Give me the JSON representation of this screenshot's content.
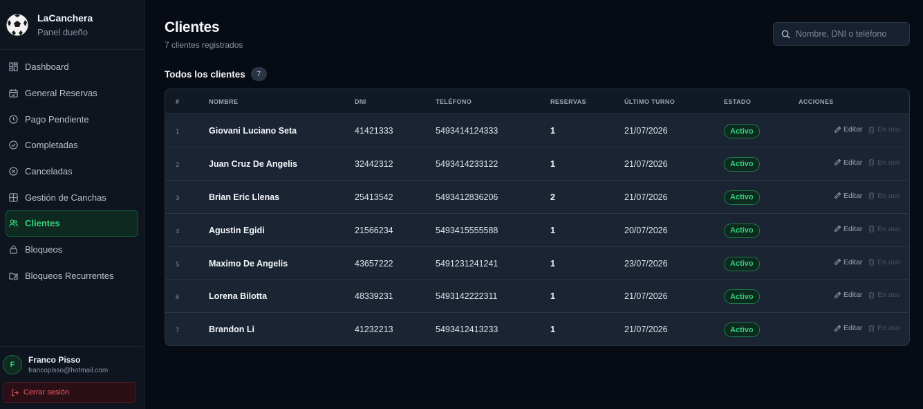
{
  "brand": {
    "name": "LaCanchera",
    "subtitle": "Panel dueño"
  },
  "nav": [
    {
      "label": "Dashboard",
      "icon": "dashboard-icon",
      "active": false
    },
    {
      "label": "General Reservas",
      "icon": "calendar-icon",
      "active": false
    },
    {
      "label": "Pago Pendiente",
      "icon": "clock-icon",
      "active": false
    },
    {
      "label": "Completadas",
      "icon": "check-circle-icon",
      "active": false
    },
    {
      "label": "Canceladas",
      "icon": "x-circle-icon",
      "active": false
    },
    {
      "label": "Gestión de Canchas",
      "icon": "grid-icon",
      "active": false
    },
    {
      "label": "Clientes",
      "icon": "users-icon",
      "active": true
    },
    {
      "label": "Bloqueos",
      "icon": "lock-icon",
      "active": false
    },
    {
      "label": "Bloqueos Recurrentes",
      "icon": "folder-lock-icon",
      "active": false
    }
  ],
  "user": {
    "initial": "F",
    "name": "Franco Pisso",
    "email": "francopisso@hotmail.com",
    "logout_label": "Cerrar sesión"
  },
  "page": {
    "title": "Clientes",
    "subtitle": "7 clientes registrados",
    "search_placeholder": "Nombre, DNI o teléfono",
    "section_title": "Todos los clientes",
    "section_count": "7"
  },
  "table": {
    "headers": [
      "#",
      "NOMBRE",
      "DNI",
      "TELÉFONO",
      "RESERVAS",
      "ÚLTIMO TURNO",
      "ESTADO",
      "ACCIONES"
    ],
    "edit_label": "Editar",
    "delete_label": "En uso",
    "rows": [
      {
        "idx": "1",
        "name": "Giovani Luciano Seta",
        "dni": "41421333",
        "phone": "5493414124333",
        "reservas": "1",
        "ultimo": "21/07/2026",
        "estado": "Activo"
      },
      {
        "idx": "2",
        "name": "Juan Cruz De Angelis",
        "dni": "32442312",
        "phone": "5493414233122",
        "reservas": "1",
        "ultimo": "21/07/2026",
        "estado": "Activo"
      },
      {
        "idx": "3",
        "name": "Brian Eric Llenas",
        "dni": "25413542",
        "phone": "5493412836206",
        "reservas": "2",
        "ultimo": "21/07/2026",
        "estado": "Activo"
      },
      {
        "idx": "4",
        "name": "Agustin Egidi",
        "dni": "21566234",
        "phone": "5493415555588",
        "reservas": "1",
        "ultimo": "20/07/2026",
        "estado": "Activo"
      },
      {
        "idx": "5",
        "name": "Maximo De Angelis",
        "dni": "43657222",
        "phone": "5491231241241",
        "reservas": "1",
        "ultimo": "23/07/2026",
        "estado": "Activo"
      },
      {
        "idx": "6",
        "name": "Lorena Bilotta",
        "dni": "48339231",
        "phone": "5493142222311",
        "reservas": "1",
        "ultimo": "21/07/2026",
        "estado": "Activo"
      },
      {
        "idx": "7",
        "name": "Brandon Li",
        "dni": "41232213",
        "phone": "5493412413233",
        "reservas": "1",
        "ultimo": "21/07/2026",
        "estado": "Activo"
      }
    ]
  },
  "colors": {
    "accent": "#34d37d",
    "background": "#070b14",
    "sidebar": "#0e151f",
    "danger": "#f0575f"
  }
}
